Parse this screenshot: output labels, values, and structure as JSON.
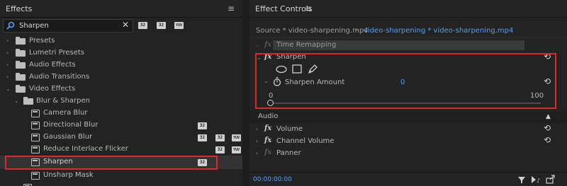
{
  "effects_panel": {
    "title": "Effects",
    "search_value": "Sharpen",
    "badges": [
      "32",
      "32",
      "YUV"
    ],
    "tree": [
      {
        "label": "Presets"
      },
      {
        "label": "Lumetri Presets"
      },
      {
        "label": "Audio Effects"
      },
      {
        "label": "Audio Transitions"
      },
      {
        "label": "Video Effects"
      },
      {
        "label": "Blur & Sharpen"
      },
      {
        "label": "Camera Blur"
      },
      {
        "label": "Directional Blur"
      },
      {
        "label": "Gaussian Blur"
      },
      {
        "label": "Reduce Interlace Flicker"
      },
      {
        "label": "Sharpen"
      },
      {
        "label": "Unsharp Mask"
      }
    ]
  },
  "effect_controls": {
    "title": "Effect Controls",
    "tabs": {
      "source": "Source * video-sharpening.mp4",
      "sequence": "video-sharpening * video-sharpening.mp4"
    },
    "time_remapping": "Time Remapping",
    "sharpen": {
      "name": "Sharpen",
      "param_label": "Sharpen Amount",
      "value": "0",
      "slider_min": "0",
      "slider_max": "100",
      "slider_level": 0
    },
    "audio_section": "Audio",
    "audio_effects": [
      "Volume",
      "Channel Volume",
      "Panner"
    ],
    "timecode": "00:00:00:00"
  },
  "colors": {
    "accent": "#2d8ceb",
    "highlight_box": "#e0262b",
    "panel_bg": "#232323"
  },
  "icons": [
    "hamburger-menu-icon",
    "search-icon",
    "clear-icon",
    "folder-icon",
    "effect-icon",
    "fx-icon",
    "ellipse-mask-icon",
    "rectangle-mask-icon",
    "pen-mask-icon",
    "stopwatch-icon",
    "reset-icon",
    "filter-icon",
    "play-audio-icon",
    "export-icon"
  ]
}
